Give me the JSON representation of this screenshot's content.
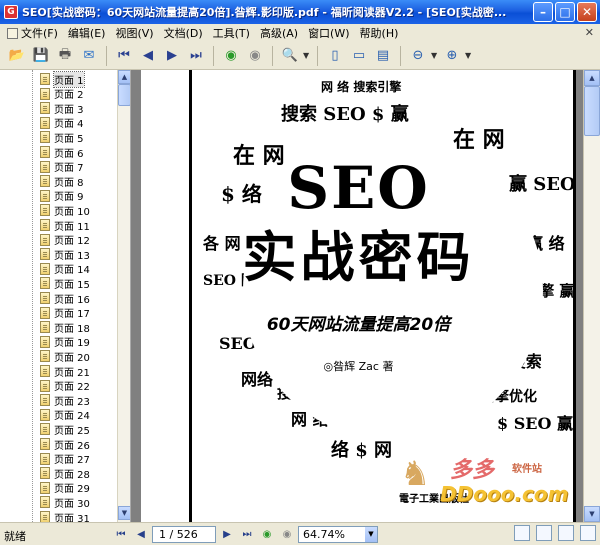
{
  "window": {
    "title": "SEO[实战密码：60天网站流量提高20倍].昝辉.影印版.pdf - 福昕阅读器V2.2 - [SEO[实战密..."
  },
  "menu": {
    "items": [
      "文件(F)",
      "编辑(E)",
      "视图(V)",
      "文档(D)",
      "工具(T)",
      "高级(A)",
      "窗口(W)",
      "帮助(H)"
    ]
  },
  "toolbar": {
    "icons": [
      "open-icon",
      "save-icon",
      "print-icon",
      "email-icon",
      "first-page-icon",
      "previous-page-icon",
      "next-page-icon",
      "last-page-icon",
      "back-icon",
      "forward-icon",
      "zoom-icon",
      "single-page-icon",
      "fit-page-icon",
      "fit-width-icon",
      "zoom-out-icon",
      "zoom-in-icon"
    ]
  },
  "sidebar": {
    "pages": [
      "页面 1",
      "页面 2",
      "页面 3",
      "页面 4",
      "页面 5",
      "页面 6",
      "页面 7",
      "页面 8",
      "页面 9",
      "页面 10",
      "页面 11",
      "页面 12",
      "页面 13",
      "页面 14",
      "页面 15",
      "页面 16",
      "页面 17",
      "页面 18",
      "页面 19",
      "页面 20",
      "页面 21",
      "页面 22",
      "页面 23",
      "页面 24",
      "页面 25",
      "页面 26",
      "页面 27",
      "页面 28",
      "页面 29",
      "页面 30",
      "页面 31"
    ],
    "selected_index": 0
  },
  "cover": {
    "title": "SEO",
    "subtitle": "实战密码",
    "tagline": "60天网站流量提高20倍",
    "author": "◎昝辉 Zac 著",
    "publisher": "電子工業出版社"
  },
  "watermark": {
    "main": "多多",
    "sub": "软件站",
    "url": "DDooo.com"
  },
  "status": {
    "text": "就绪",
    "page": "1 / 526",
    "zoom": "64.74%"
  }
}
